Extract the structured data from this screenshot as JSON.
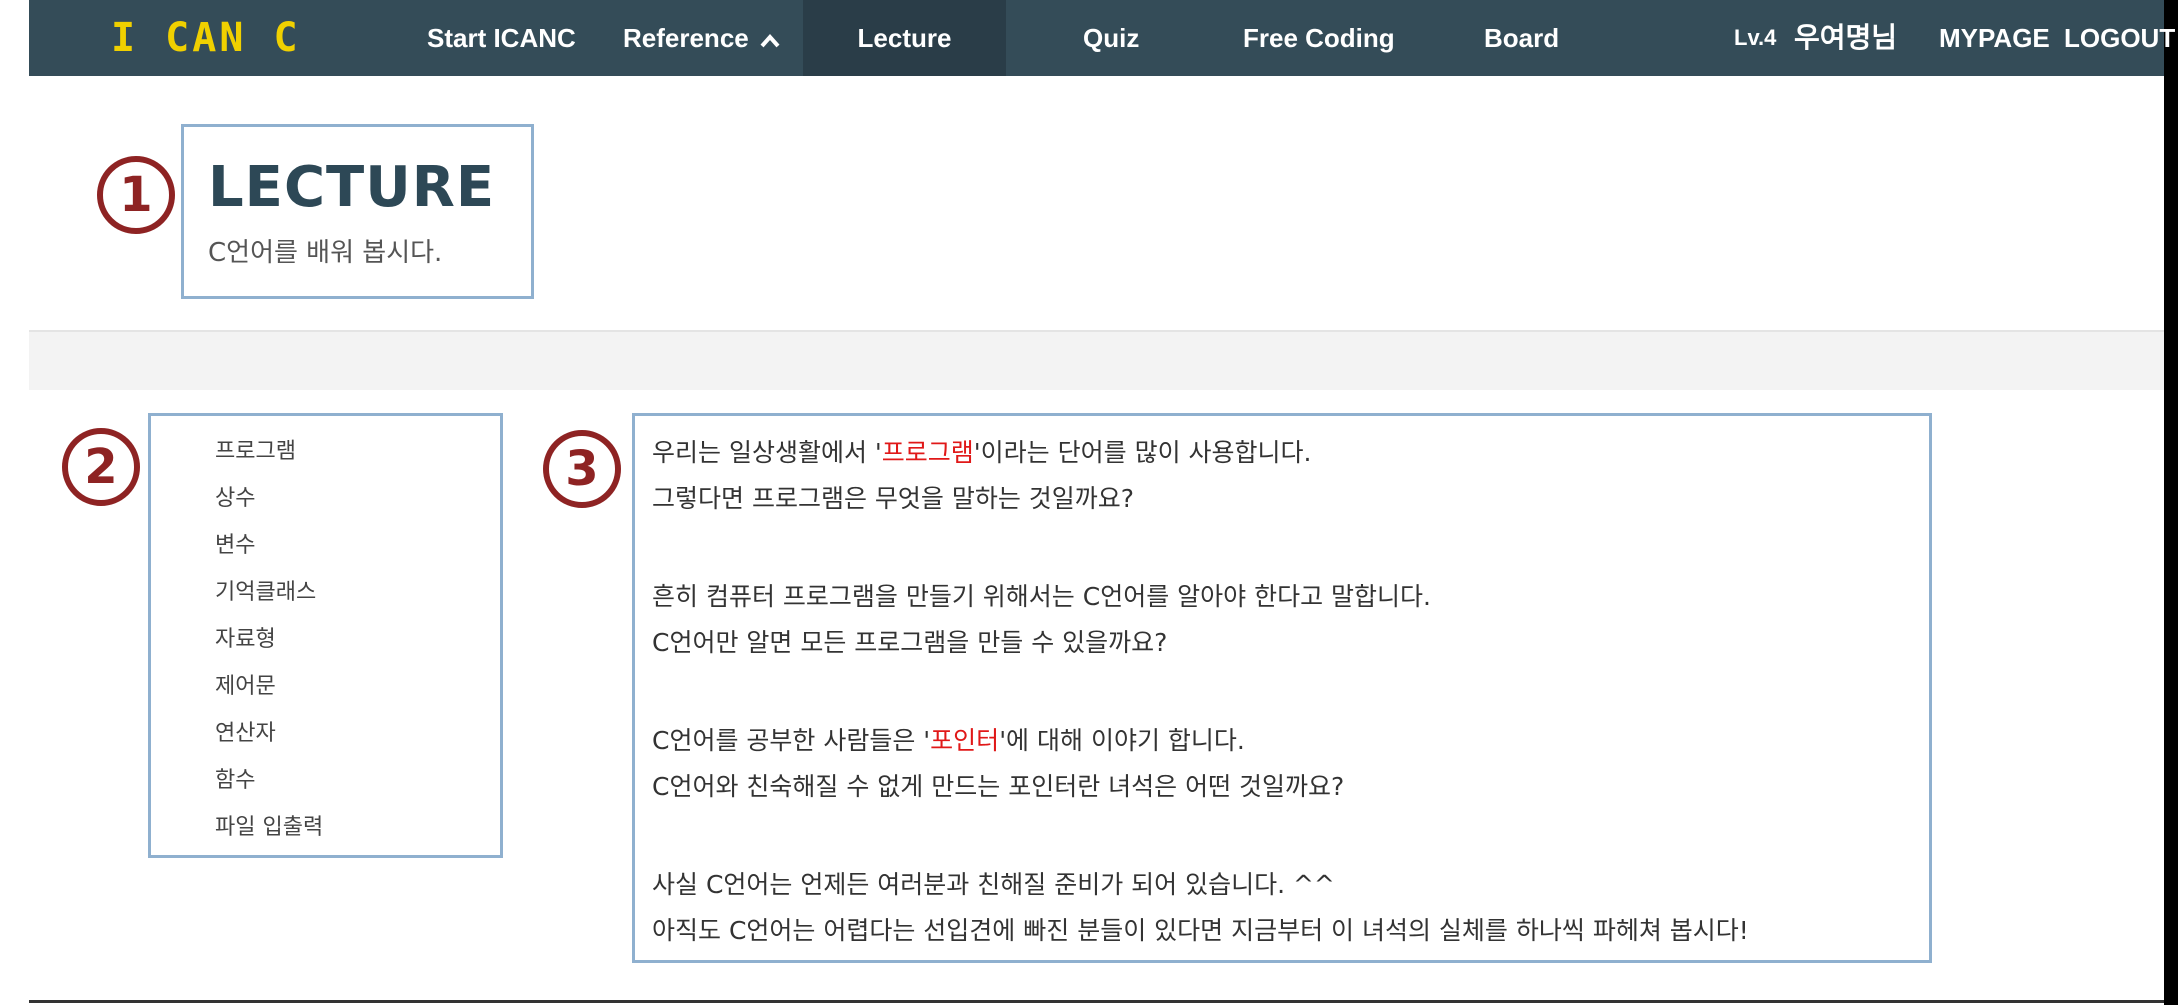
{
  "nav": {
    "brand": "I CAN C",
    "start": "Start ICANC",
    "reference": "Reference",
    "lecture": "Lecture",
    "quiz": "Quiz",
    "free_coding": "Free Coding",
    "board": "Board",
    "level": "Lv.4",
    "user": "우여명님",
    "mypage": "MYPAGE",
    "logout": "LOGOUT"
  },
  "header": {
    "title": "LECTURE",
    "subtitle": "C언어를 배워 봅시다."
  },
  "badges": [
    "1",
    "2",
    "3"
  ],
  "sidebar": {
    "items": [
      {
        "label": "프로그램"
      },
      {
        "label": "상수"
      },
      {
        "label": "변수"
      },
      {
        "label": "기억클래스"
      },
      {
        "label": "자료형"
      },
      {
        "label": "제어문"
      },
      {
        "label": "연산자"
      },
      {
        "label": "함수"
      },
      {
        "label": "파일 입출력"
      }
    ]
  },
  "content": {
    "l1_a": "우리는 일상생활에서 '",
    "l1_hl": "프로그램",
    "l1_b": "'이라는 단어를 많이 사용합니다.",
    "l2": "그렇다면 프로그램은 무엇을 말하는 것일까요?",
    "l3": "흔히 컴퓨터 프로그램을 만들기 위해서는 C언어를 알아야 한다고 말합니다.",
    "l4": "C언어만 알면 모든 프로그램을 만들 수 있을까요?",
    "l5_a": "C언어를 공부한 사람들은 '",
    "l5_hl": "포인터",
    "l5_b": "'에 대해 이야기 합니다.",
    "l6": "C언어와 친숙해질 수 없게 만드는 포인터란 녀석은 어떤 것일까요?",
    "l7": "사실 C언어는 언제든 여러분과 친해질 준비가 되어 있습니다. ^^",
    "l8": "아직도 C언어는 어렵다는 선입견에 빠진 분들이 있다면 지금부터 이 녀석의 실체를 하나씩 파헤쳐 봅시다!"
  },
  "colors": {
    "navbar": "#344c58",
    "navbar_active": "#2a3d48",
    "brand": "#f0d000",
    "box_border": "#8fb0cf",
    "badge": "#8e2323",
    "highlight": "#e01818"
  }
}
